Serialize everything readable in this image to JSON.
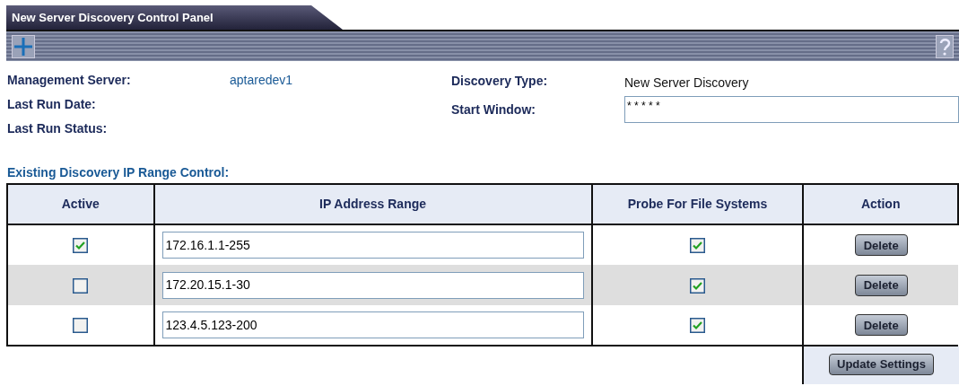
{
  "panel": {
    "title": "New Server Discovery Control Panel"
  },
  "info_left": [
    {
      "label": "Management Server:",
      "value": "aptaredev1"
    },
    {
      "label": "Last Run Date:"
    },
    {
      "label": "Last Run Status:"
    }
  ],
  "info_right": [
    {
      "label": "Discovery Type:",
      "kind": "text",
      "value": "New Server Discovery"
    },
    {
      "label": "Start Window:",
      "kind": "field",
      "value": "* * * * *"
    }
  ],
  "section_title": "Existing Discovery IP Range Control:",
  "table": {
    "columns": [
      "Active",
      "IP Address Range",
      "Probe For File Systems",
      "Action"
    ],
    "rows": [
      {
        "active": true,
        "range": "172.16.1.1-255",
        "probe": true,
        "action": "Delete"
      },
      {
        "active": false,
        "range": "172.20.15.1-30",
        "probe": true,
        "action": "Delete"
      },
      {
        "active": false,
        "range": "123.4.5.123-200",
        "probe": true,
        "action": "Delete"
      }
    ]
  },
  "buttons": [
    "Update Settings"
  ]
}
